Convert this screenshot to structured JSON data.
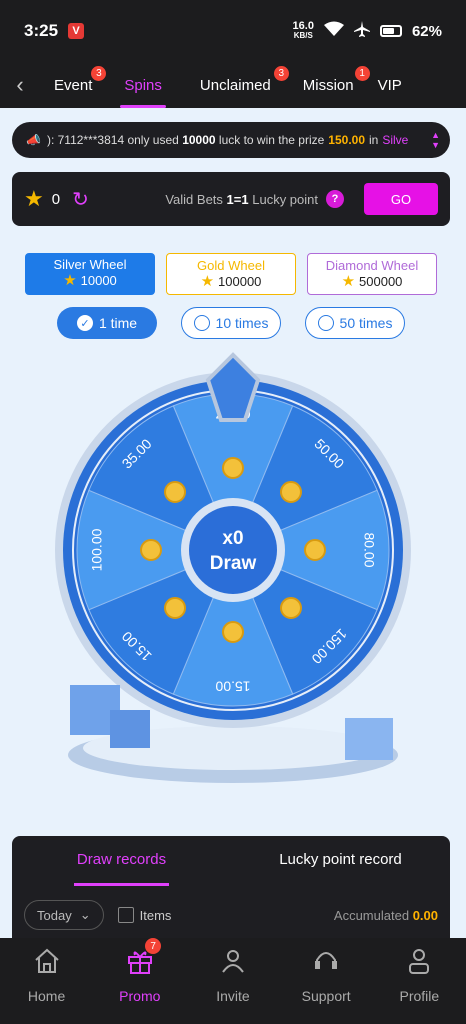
{
  "status": {
    "time": "3:25",
    "app_badge": "V",
    "net_speed": "16.0",
    "net_unit": "KB/S",
    "battery": "62%"
  },
  "tabs": [
    {
      "label": "Event",
      "badge": "3"
    },
    {
      "label": "Spins",
      "badge": ""
    },
    {
      "label": "Unclaimed",
      "badge": "3"
    },
    {
      "label": "Mission",
      "badge": "1"
    },
    {
      "label": "VIP",
      "badge": ""
    }
  ],
  "ticker": {
    "prefix": "): 7112***3814 only used",
    "luck": "10000",
    "middle": "luck to win the prize",
    "prize": "150.00",
    "in": "in",
    "wheel": "Silve"
  },
  "points": {
    "value": "0",
    "valid_label": "Valid Bets",
    "ratio": "1=1",
    "lucky_label": "Lucky point",
    "help": "?",
    "go": "GO"
  },
  "wheels": [
    {
      "name": "Silver Wheel",
      "cost": "10000"
    },
    {
      "name": "Gold Wheel",
      "cost": "100000"
    },
    {
      "name": "Diamond Wheel",
      "cost": "500000"
    }
  ],
  "times": [
    {
      "label": "1 time"
    },
    {
      "label": "10 times"
    },
    {
      "label": "50 times"
    }
  ],
  "spinner": {
    "center_top": "x0",
    "center_bottom": "Draw",
    "segments": [
      "20.00",
      "50.00",
      "80.00",
      "150.00",
      "15.00",
      "15.00",
      "100.00",
      "35.00"
    ]
  },
  "records": {
    "tab_draw": "Draw records",
    "tab_lucky": "Lucky point record",
    "filter_day": "Today",
    "items_label": "Items",
    "accumulated_label": "Accumulated",
    "accumulated_value": "0.00"
  },
  "nav": [
    {
      "label": "Home",
      "badge": ""
    },
    {
      "label": "Promo",
      "badge": "7"
    },
    {
      "label": "Invite",
      "badge": ""
    },
    {
      "label": "Support",
      "badge": ""
    },
    {
      "label": "Profile",
      "badge": ""
    }
  ],
  "colors": {
    "accent": "#e040fb",
    "primary": "#1e7be8",
    "gold": "#f5b800",
    "diamond": "#b06bd8"
  }
}
